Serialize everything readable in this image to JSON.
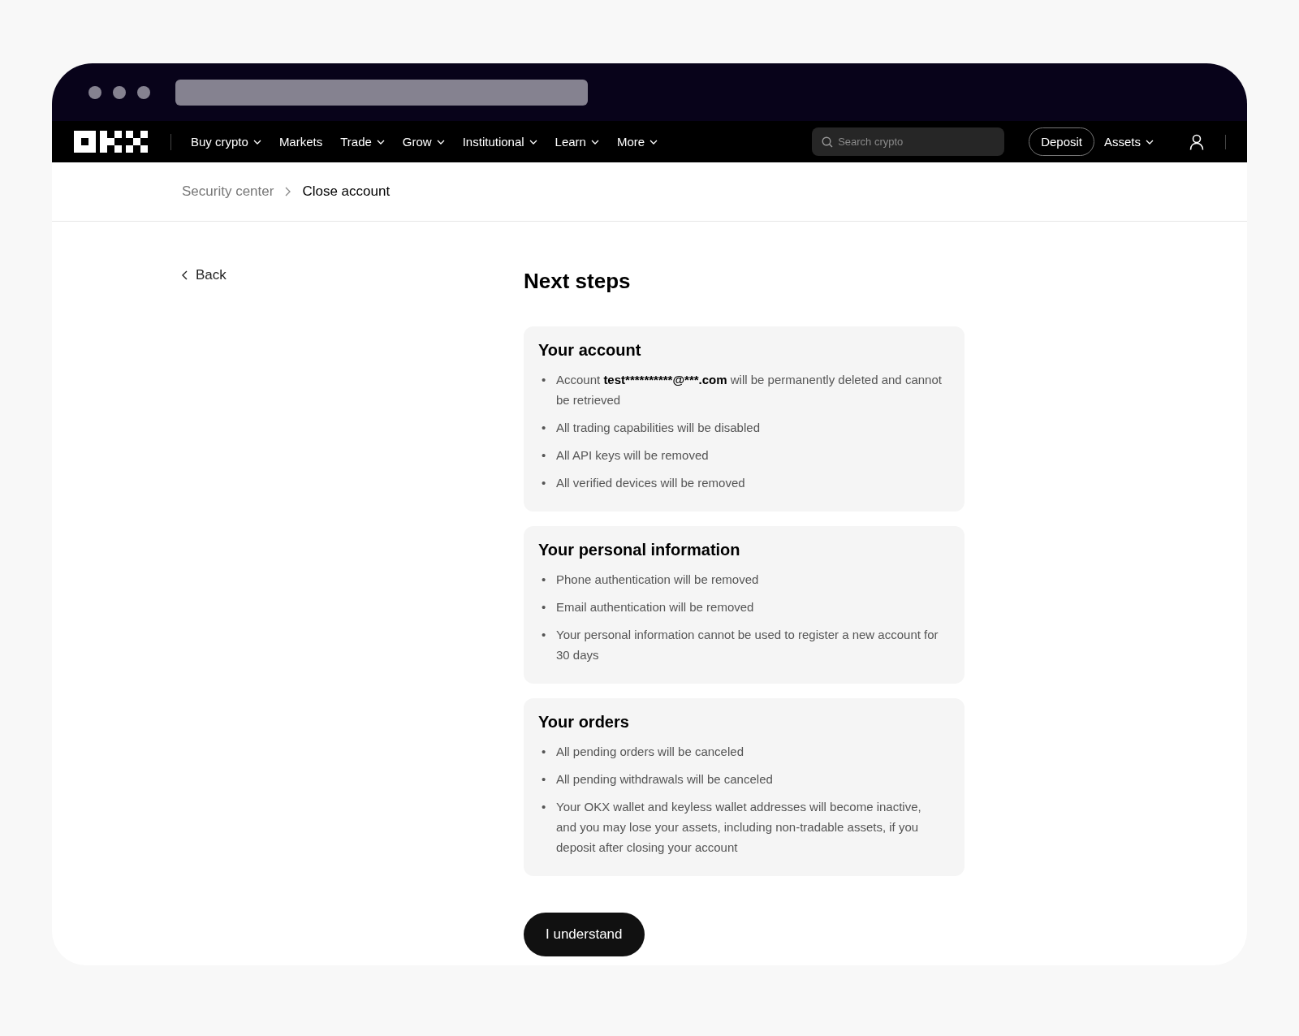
{
  "nav": {
    "items": [
      {
        "label": "Buy crypto",
        "has_menu": true
      },
      {
        "label": "Markets",
        "has_menu": false
      },
      {
        "label": "Trade",
        "has_menu": true
      },
      {
        "label": "Grow",
        "has_menu": true
      },
      {
        "label": "Institutional",
        "has_menu": true
      },
      {
        "label": "Learn",
        "has_menu": true
      },
      {
        "label": "More",
        "has_menu": true
      }
    ],
    "search": {
      "placeholder": "Search crypto"
    },
    "deposit": "Deposit",
    "assets": {
      "label": "Assets",
      "has_menu": true
    }
  },
  "breadcrumb": [
    {
      "label": "Security center",
      "selected": false
    },
    {
      "label": "Close account",
      "selected": true
    }
  ],
  "back": "Back",
  "title": "Next steps",
  "bullet": "•",
  "cards": [
    {
      "title": "Your account",
      "items": [
        {
          "before": "Account ",
          "bold": "test**********@***.com",
          "after": " will be permanently deleted and cannot be retrieved"
        },
        {
          "before": "All trading capabilities will be disabled"
        },
        {
          "before": "All API keys will be removed"
        },
        {
          "before": "All verified devices will be removed"
        }
      ]
    },
    {
      "title": "Your personal information",
      "items": [
        {
          "before": "Phone authentication will be removed"
        },
        {
          "before": "Email authentication will be removed"
        },
        {
          "before": "Your personal information cannot be used to register a new account for 30 days"
        }
      ]
    },
    {
      "title": "Your orders",
      "items": [
        {
          "before": "All pending orders will be canceled"
        },
        {
          "before": "All pending withdrawals will be canceled"
        },
        {
          "before": "Your OKX wallet and keyless wallet addresses will become inactive, and you may lose your assets, including non-tradable assets, if you deposit after closing your account"
        }
      ]
    }
  ],
  "button": "I understand"
}
